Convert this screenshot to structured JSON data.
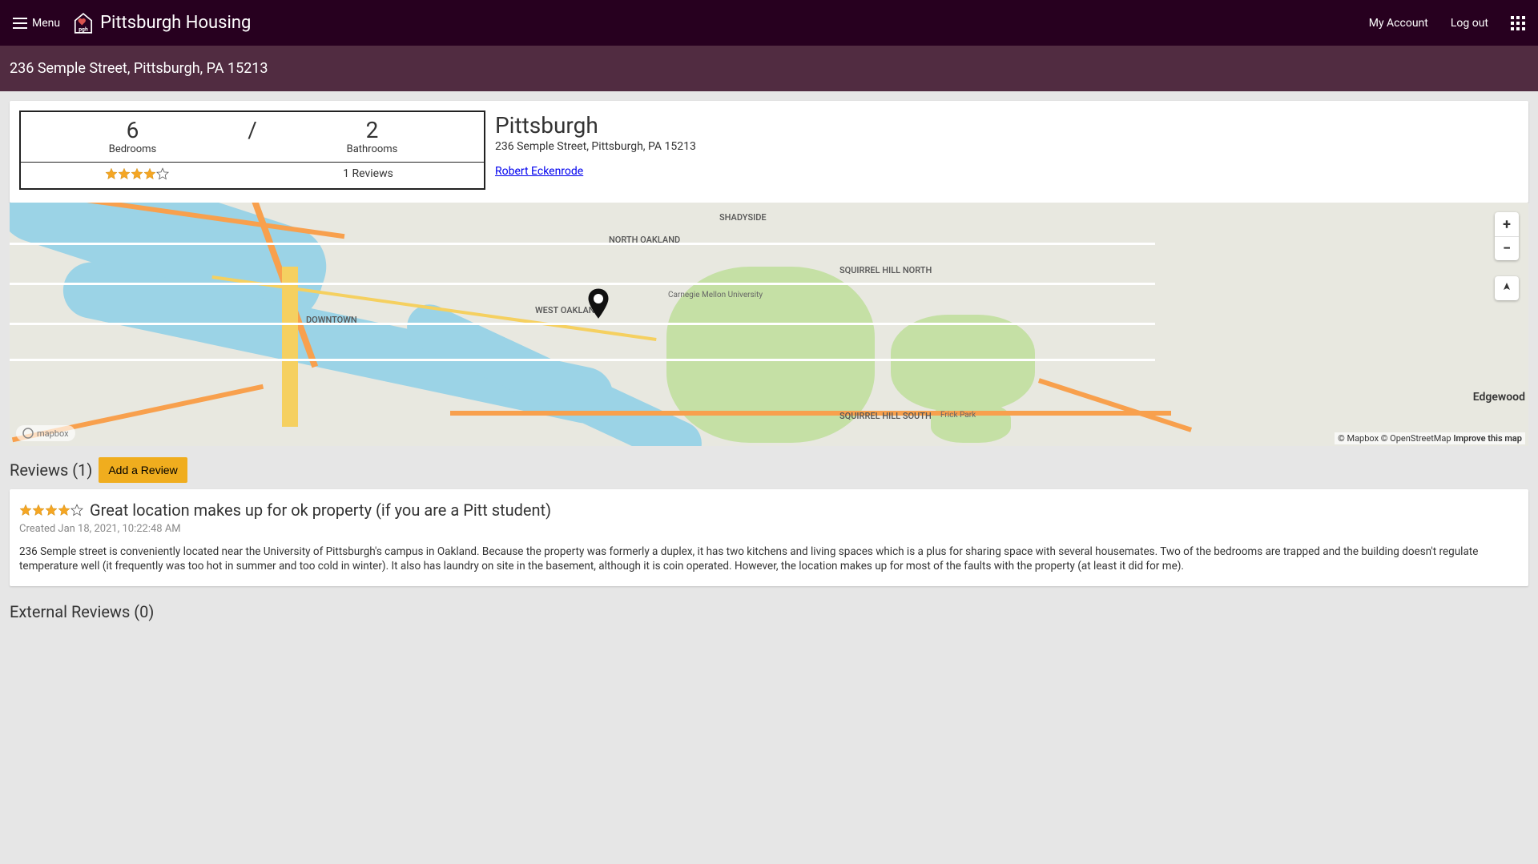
{
  "nav": {
    "menu_label": "Menu",
    "brand": "Pittsburgh Housing",
    "my_account": "My Account",
    "log_out": "Log out"
  },
  "sub_header": {
    "address": "236 Semple Street, Pittsburgh, PA 15213"
  },
  "property": {
    "bedrooms": "6",
    "bedrooms_label": "Bedrooms",
    "separator": "/",
    "bathrooms": "2",
    "bathrooms_label": "Bathrooms",
    "reviews_count": "1 Reviews",
    "city": "Pittsburgh",
    "full_address": "236 Semple Street, Pittsburgh, PA 15213",
    "owner": "Robert Eckenrode",
    "rating_filled": 4,
    "rating_total": 5
  },
  "map": {
    "zoom_in": "+",
    "zoom_out": "−",
    "mapbox_label": "mapbox",
    "attrib_mapbox": "© Mapbox",
    "attrib_osm": "© OpenStreetMap",
    "improve": "Improve this map",
    "labels": {
      "edgewood": "Edgewood"
    }
  },
  "reviews": {
    "header": "Reviews (1)",
    "add_button": "Add a Review",
    "items": [
      {
        "rating_filled": 4,
        "title": "Great location makes up for ok property (if you are a Pitt student)",
        "meta": "Created Jan 18, 2021, 10:22:48 AM",
        "body": "236 Semple street is conveniently located near the University of Pittsburgh's campus in Oakland. Because the property was formerly a duplex, it has two kitchens and living spaces which is a plus for sharing space with several housemates. Two of the bedrooms are trapped and the building doesn't regulate temperature well (it frequently was too hot in summer and too cold in winter). It also has laundry on site in the basement, although it is coin operated. However, the location makes up for most of the faults with the property (at least it did for me)."
      }
    ]
  },
  "external": {
    "header": "External Reviews (0)"
  }
}
